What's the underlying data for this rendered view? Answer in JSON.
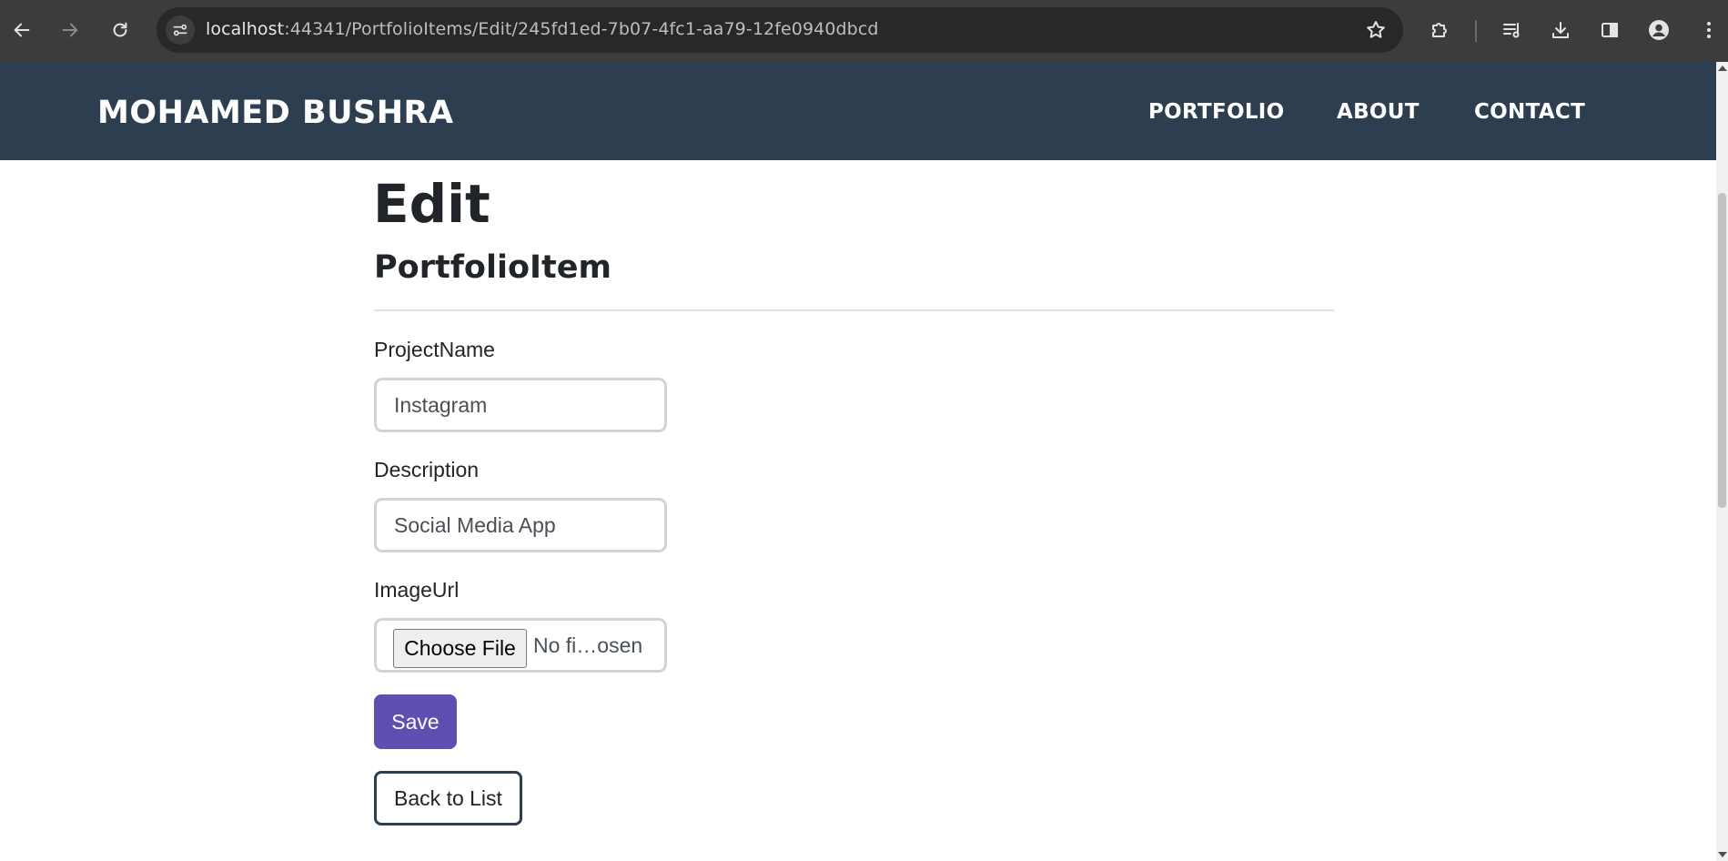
{
  "browser": {
    "url_host": "localhost",
    "url_rest": ":44341/PortfolioItems/Edit/245fd1ed-7b07-4fc1-aa79-12fe0940dbcd",
    "icons": [
      "back-arrow-icon",
      "forward-arrow-icon",
      "reload-icon",
      "site-info-icon",
      "star-icon",
      "extensions-icon",
      "media-control-icon",
      "download-icon",
      "side-panel-icon",
      "profile-icon",
      "kebab-menu-icon"
    ]
  },
  "navbar": {
    "brand": "MOHAMED BUSHRA",
    "links": [
      "PORTFOLIO",
      "ABOUT",
      "CONTACT"
    ],
    "background_color": "#2c3e50"
  },
  "page": {
    "title": "Edit",
    "subtitle": "PortfolioItem"
  },
  "form": {
    "project_name": {
      "label": "ProjectName",
      "value": "Instagram"
    },
    "description": {
      "label": "Description",
      "value": "Social Media App"
    },
    "image_url": {
      "label": "ImageUrl",
      "button_label": "Choose File",
      "status": "No fi…osen"
    },
    "save_label": "Save",
    "save_color": "#5e50b3"
  },
  "back_link_label": "Back to List"
}
